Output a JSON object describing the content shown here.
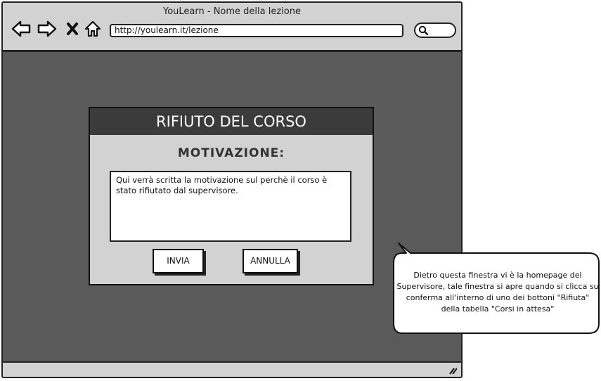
{
  "browser": {
    "title": "YouLearn - Nome della lezione",
    "url": "http://youlearn.it/lezione",
    "nav_icons": [
      "back-arrow-icon",
      "forward-arrow-icon",
      "close-icon",
      "home-icon"
    ],
    "search_icon": "search-icon"
  },
  "dialog": {
    "title": "RIFIUTO DEL CORSO",
    "label": "MOTIVAZIONE:",
    "textarea_value": "Qui verrà scritta la motivazione sul perchè il corso è stato rifiutato dal supervisore.",
    "buttons": {
      "send": "INVIA",
      "cancel": "ANNULLA"
    }
  },
  "annotation": {
    "text": "Dietro questa finestra vi è la homepage del Supervisore, tale finestra si apre quando si clicca su conferma all'interno di uno dei bottoni \"Rifiuta\" della tabella \"Corsi in attesa\""
  },
  "colors": {
    "page_background": "#5a5a5a",
    "chrome": "#d2d2d2",
    "dialog_header": "#3b3b3b"
  }
}
